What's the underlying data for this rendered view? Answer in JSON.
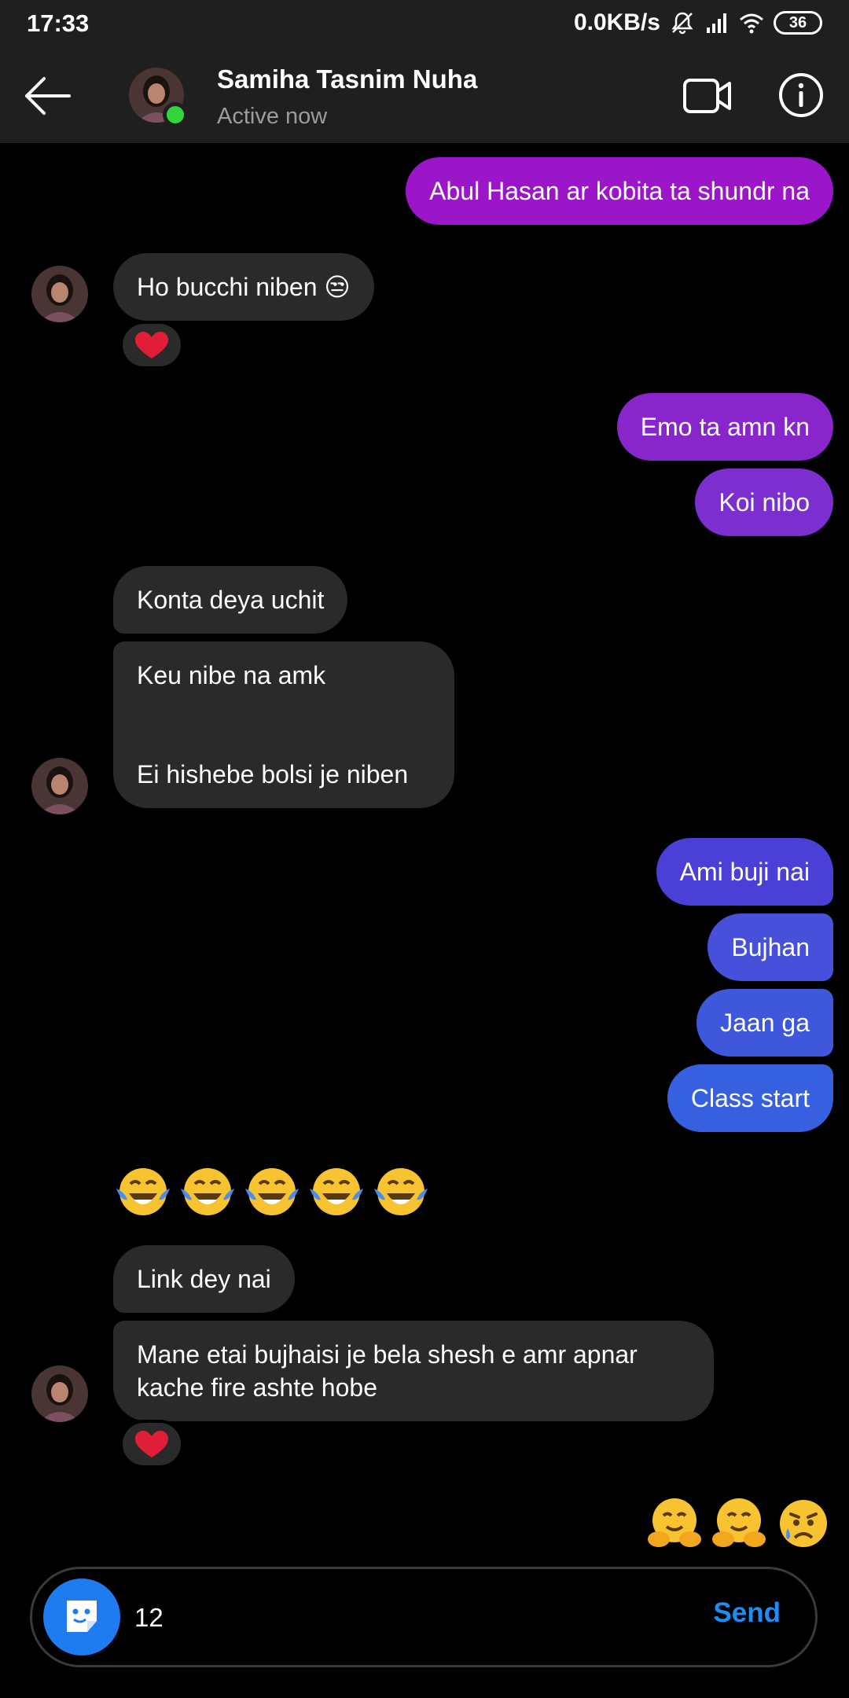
{
  "status_bar": {
    "time": "17:33",
    "network_speed": "0.0KB/s",
    "battery": "36"
  },
  "header": {
    "name": "Samiha Tasnim Nuha",
    "status": "Active now"
  },
  "messages": [
    {
      "from": "me",
      "text": "Abul Hasan ar kobita ta shundr na",
      "color": "#9a16c8"
    },
    {
      "from": "them",
      "text": "Ho bucchi niben 😒",
      "reaction": "heart"
    },
    {
      "from": "me",
      "text": "Emo ta amn kn",
      "color": "#8826cb"
    },
    {
      "from": "me",
      "text": "Koi nibo",
      "color": "#7c2ecf"
    },
    {
      "from": "them",
      "text": "Konta deya uchit"
    },
    {
      "from": "them",
      "text": "Keu nibe na amk\n\n\nEi hishebe bolsi je niben"
    },
    {
      "from": "me",
      "text": "Ami buji nai",
      "color": "#4a3fd6"
    },
    {
      "from": "me",
      "text": "Bujhan",
      "color": "#4650da"
    },
    {
      "from": "me",
      "text": "Jaan ga",
      "color": "#3f58db"
    },
    {
      "from": "me",
      "text": "Class start",
      "color": "#3660e0"
    },
    {
      "from": "them",
      "emojis": [
        "face-with-tears-of-joy",
        "face-with-tears-of-joy",
        "face-with-tears-of-joy",
        "face-with-tears-of-joy",
        "face-with-tears-of-joy"
      ]
    },
    {
      "from": "them",
      "text": "Link dey nai"
    },
    {
      "from": "them",
      "text": "Mane etai bujhaisi je bela shesh e amr apnar\nkache fire ashte hobe",
      "reaction": "heart"
    },
    {
      "from": "me",
      "emojis": [
        "hugging-face",
        "hugging-face",
        "sad-but-relieved-face"
      ]
    }
  ],
  "composer": {
    "input_value": "12",
    "send_label": "Send"
  },
  "colors": {
    "header_bg": "#1f1f1f",
    "incoming_bubble": "#2a2a2a",
    "online": "#2fd53b",
    "send_blue": "#1e8cf5"
  }
}
